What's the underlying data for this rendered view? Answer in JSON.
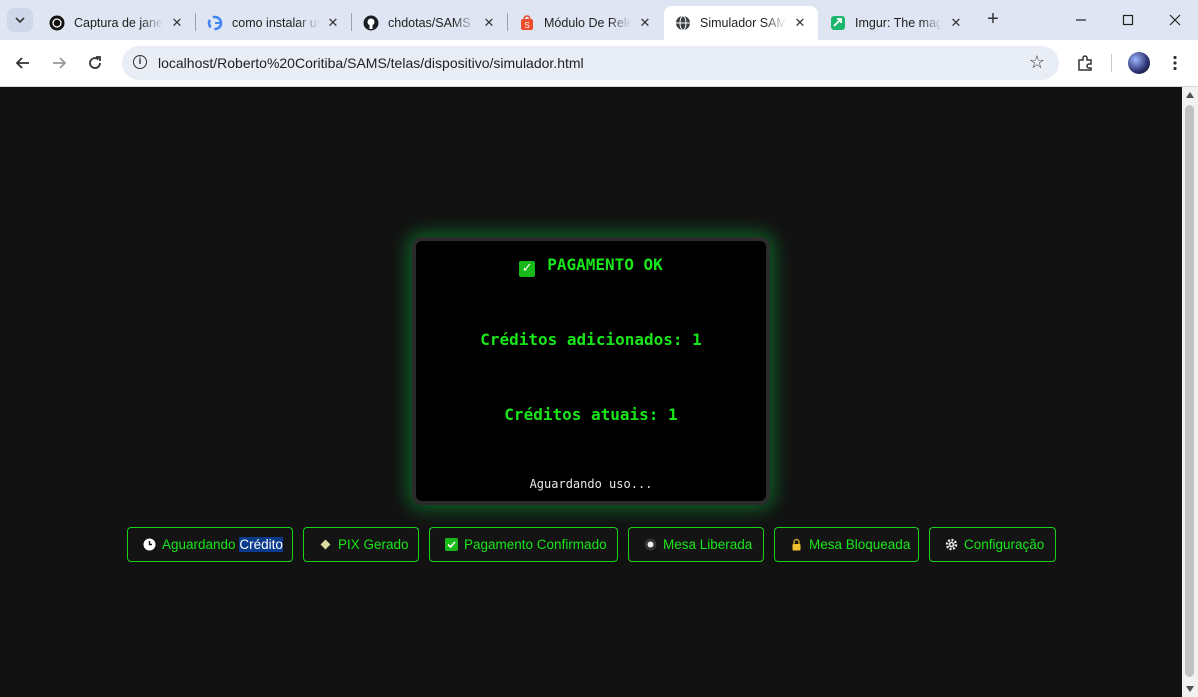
{
  "browser": {
    "tabs": [
      {
        "title": "Captura de janela",
        "favicon": "openai-icon"
      },
      {
        "title": "como instalar um",
        "favicon": "google-icon"
      },
      {
        "title": "chdotas/SAMS",
        "favicon": "github-icon"
      },
      {
        "title": "Módulo De Relé",
        "favicon": "shopee-icon"
      },
      {
        "title": "Simulador SAMS",
        "favicon": "globe-icon",
        "active": true
      },
      {
        "title": "Imgur: The magic",
        "favicon": "imgur-icon"
      }
    ],
    "url": "localhost/Roberto%20Coritiba/SAMS/telas/dispositivo/simulador.html"
  },
  "screen": {
    "title": "PAGAMENTO OK",
    "line1": "Créditos adicionados: 1",
    "line2": "Créditos atuais: 1",
    "footer": "Aguardando uso..."
  },
  "buttons": {
    "aguardando_a": "Aguardando ",
    "aguardando_b": "Crédito",
    "pix": "PIX Gerado",
    "pagamento": "Pagamento Confirmado",
    "mesa_liberada": "Mesa Liberada",
    "mesa_bloqueada": "Mesa Bloqueada",
    "configuracao": "Configuração"
  },
  "colors": {
    "accent": "#19e619",
    "background": "#121212",
    "screen": "#000000"
  }
}
